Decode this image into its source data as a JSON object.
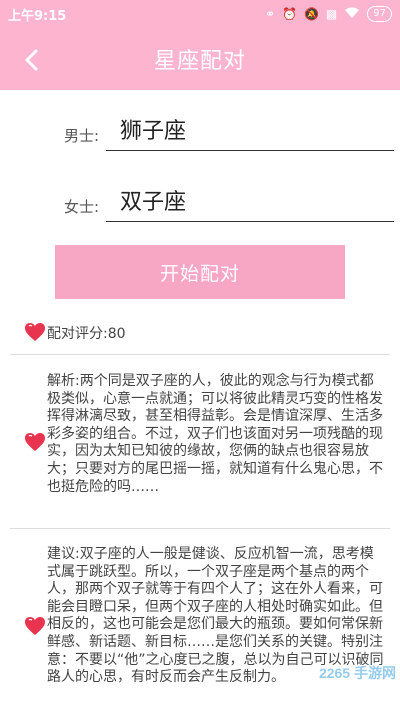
{
  "status_bar": {
    "time": "上午9:15",
    "battery": "97"
  },
  "app_bar": {
    "title": "星座配对"
  },
  "form": {
    "male_label": "男士:",
    "male_value": "狮子座",
    "female_label": "女士:",
    "female_value": "双子座"
  },
  "match_button_label": "开始配对",
  "result": {
    "score_text": "配对评分:80",
    "analysis_text": "解析:两个同是双子座的人，彼此的观念与行为模式都极类似，心意一点就通；可以将彼此精灵巧变的性格发挥得淋漓尽致，甚至相得益彰。会是情谊深厚、生活多彩多姿的组合。不过，双子们也该面对另一项残酷的现实，因为太知已知彼的缘故，您俩的缺点也很容易放大；只要对方的尾巴摇一摇，就知道有什么鬼心思，不也挺危险的吗……",
    "advice_text": "建议:双子座的人一般是健谈、反应机智一流，思考模式属于跳跃型。所以，一个双子座是两个基点的两个人，那两个双子就等于有四个人了；这在外人看来，可能会目瞪口呆，但两个双子座的人相处时确实如此。但相反的，这也可能会是您们最大的瓶颈。要如何常保新鲜感、新话题、新目标……是您们关系的关键。特别注意：不要以“他”之心度已之腹，总以为自己可以识破同路人的心思，有时反而会产生反制力。"
  },
  "watermark": "2265 手游网",
  "colors": {
    "primary_pink": "#fdb5cf",
    "button_pink": "#f7a6c4",
    "heart_red": "#e8344e"
  }
}
